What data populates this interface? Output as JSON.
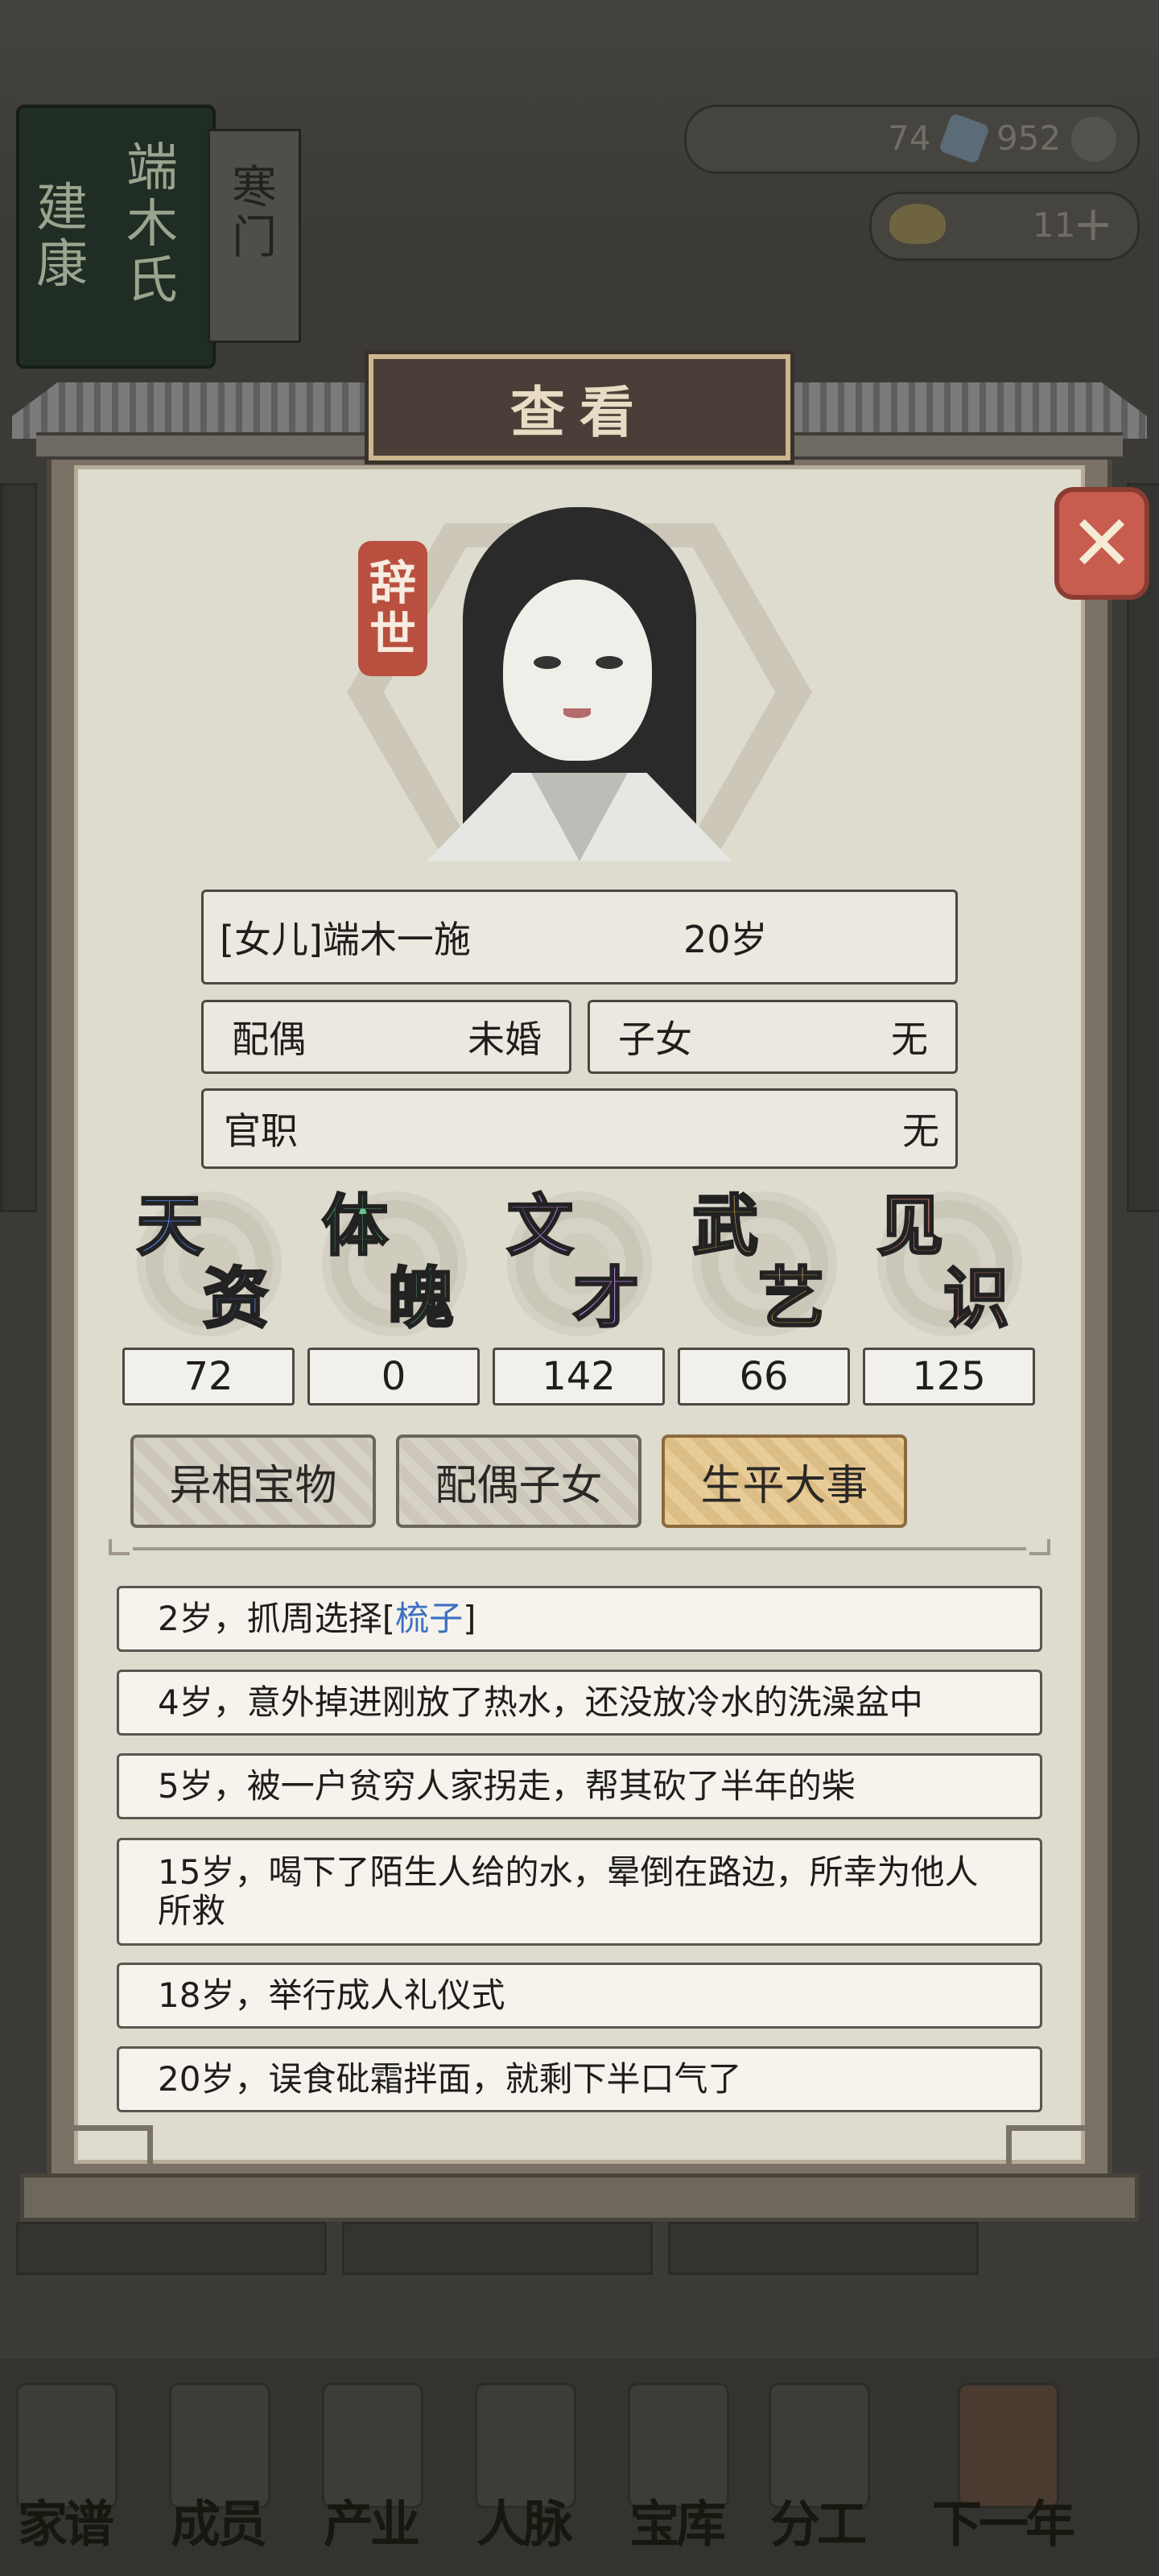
{
  "background": {
    "family_banner": {
      "clan_name": "建康",
      "family": "端木氏",
      "rank": "寒门"
    },
    "resources": {
      "coins_left": "74",
      "coins_right": "952",
      "gold": "11"
    },
    "bottom_nav": [
      "家谱",
      "成员",
      "产业",
      "人脉",
      "宝库",
      "分工",
      "下一年"
    ]
  },
  "dialog": {
    "title": "查看",
    "close_icon": "close-x-icon",
    "status_seal": [
      "辞",
      "世"
    ],
    "identity": {
      "name": "[女儿]端木一施",
      "age": "20岁"
    },
    "spouse": {
      "label": "配偶",
      "value": "未婚"
    },
    "children": {
      "label": "子女",
      "value": "无"
    },
    "office": {
      "label": "官职",
      "value": "无"
    },
    "attributes": [
      {
        "c1": "天",
        "c2": "资",
        "value": "72",
        "color": "#5a84e8"
      },
      {
        "c1": "体",
        "c2": "魄",
        "value": "0",
        "color": "#63c58b"
      },
      {
        "c1": "文",
        "c2": "才",
        "value": "142",
        "color": "#b47ee0"
      },
      {
        "c1": "武",
        "c2": "艺",
        "value": "66",
        "color": "#f0c25a"
      },
      {
        "c1": "见",
        "c2": "识",
        "value": "125",
        "color": "#e6867c"
      }
    ],
    "tabs": [
      {
        "label": "异相宝物",
        "active": false
      },
      {
        "label": "配偶子女",
        "active": false
      },
      {
        "label": "生平大事",
        "active": true
      }
    ],
    "events": [
      {
        "pre": "2岁，抓周选择[",
        "highlight": "梳子",
        "post": "]"
      },
      {
        "pre": "4岁，意外掉进刚放了热水，还没放冷水的洗澡盆中",
        "highlight": "",
        "post": ""
      },
      {
        "pre": "5岁，被一户贫穷人家拐走，帮其砍了半年的柴",
        "highlight": "",
        "post": ""
      },
      {
        "pre": "15岁，喝下了陌生人给的水，晕倒在路边，所幸为他人所救",
        "highlight": "",
        "post": ""
      },
      {
        "pre": "18岁，举行成人礼仪式",
        "highlight": "",
        "post": ""
      },
      {
        "pre": "20岁，误食砒霜拌面，就剩下半口气了",
        "highlight": "",
        "post": ""
      }
    ]
  }
}
